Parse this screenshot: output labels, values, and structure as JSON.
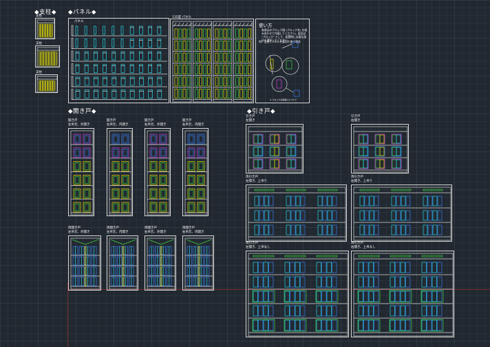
{
  "sections": {
    "pillar": "◆支柱◆",
    "panel": "◆パネル◆",
    "hinged": "◆開き戸◆",
    "sliding": "◆引き戸◆"
  },
  "pillar_labels": [
    "支柱",
    "支柱",
    "支柱"
  ],
  "panel_label": "パネル",
  "panel135_label": "135度 パネル",
  "howto": {
    "title": "使い方",
    "text": "各部品のブロック図 (ブロック名) を組み合わせて作図してください。部品は \"ブロック\" として、配置時に必要な部分を選択してください。",
    "step": "例）支柱とパネルを重ねて使う場合",
    "footer": "※ ブロックの取扱いについて"
  },
  "hinged_top": [
    {
      "l1": "開き戸",
      "l2": "左吊元、外開き"
    },
    {
      "l1": "開き戸",
      "l2": "左吊元、内開き"
    },
    {
      "l1": "開き戸",
      "l2": "右吊元、外開き"
    },
    {
      "l1": "開き戸",
      "l2": "右吊元、内開き"
    }
  ],
  "hinged_bottom": [
    {
      "l1": "両開き戸",
      "l2": "左吊元、外開き"
    },
    {
      "l1": "両開き戸",
      "l2": "左吊元、内開き"
    },
    {
      "l1": "両開き戸",
      "l2": "右吊元、外開き"
    },
    {
      "l1": "両開き戸",
      "l2": "右吊元、内開き"
    }
  ],
  "sliding_top": [
    {
      "l1": "引き戸",
      "l2": "左開き"
    },
    {
      "l1": "引き戸",
      "l2": "右開き"
    }
  ],
  "sliding_mid": [
    {
      "l1": "両引き戸",
      "l2": "左開き、上吊り"
    },
    {
      "l1": "両引き戸",
      "l2": "右開き、上吊り"
    }
  ],
  "sliding_bot": [
    {
      "l1": "両引き戸",
      "l2": "左開き、上吊なし"
    },
    {
      "l1": "両引き戸",
      "l2": "右開き、上吊なし"
    }
  ],
  "colors": {
    "background": "#212830",
    "grid": "#2f3843",
    "frame": "#d8d8d8",
    "cyan": "#25d6e6",
    "green": "#3fd43f",
    "yellow": "#e8e000",
    "magenta": "#d040e0",
    "blue": "#3a7cf0",
    "axis": "#7a2d2d"
  }
}
